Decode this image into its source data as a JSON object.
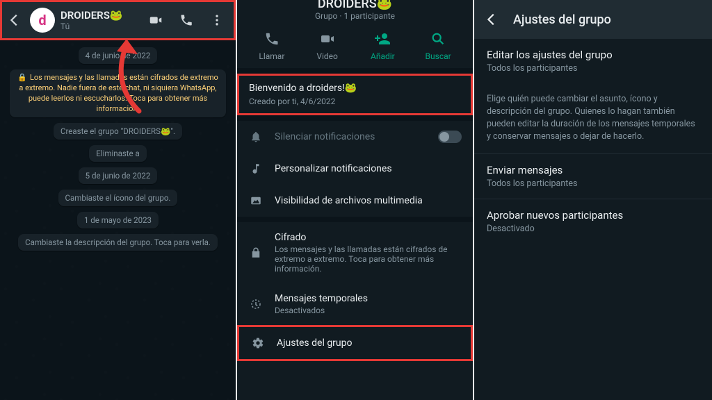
{
  "panel1": {
    "header": {
      "title": "DROIDERS🐸",
      "subtitle": "Tú"
    },
    "avatar_letter": "d",
    "messages": {
      "date1": "4 de junio de 2022",
      "encryption": "Los mensajes y las llamadas están cifrados de extremo a extremo. Nadie fuera de este chat, ni siquiera WhatsApp, puede leerlos ni escucharlos. Toca para obtener más información.",
      "created": "Creaste el grupo \"DROIDERS🐸\".",
      "eliminated": "Eliminaste a",
      "date2": "5 de junio de 2022",
      "icon_changed": "Cambiaste el ícono del grupo.",
      "date3": "1 de mayo de 2023",
      "desc_changed": "Cambiaste la descripción del grupo. Toca para verla."
    }
  },
  "panel2": {
    "group_title": "DROIDERS🐸",
    "group_sub": "Grupo · 1 participante",
    "actions": {
      "call": "Llamar",
      "video": "Video",
      "add": "Añadir",
      "search": "Buscar"
    },
    "welcome": {
      "title": "Bienvenido a droiders!🐸",
      "sub": "Creado por ti, 4/6/2022"
    },
    "menu": {
      "mute": "Silenciar notificaciones",
      "custom_notif": "Personalizar notificaciones",
      "media_vis": "Visibilidad de archivos multimedia",
      "encryption": "Cifrado",
      "encryption_sub": "Los mensajes y las llamadas están cifrados de extremo a extremo. Toca para obtener más información.",
      "temp": "Mensajes temporales",
      "temp_sub": "Desactivados",
      "settings": "Ajustes del grupo"
    }
  },
  "panel3": {
    "title": "Ajustes del grupo",
    "edit": {
      "title": "Editar los ajustes del grupo",
      "sub": "Todos los participantes"
    },
    "info": "Elige quién puede cambiar el asunto, ícono y descripción del grupo. Quienes lo hagan también pueden editar la duración de los mensajes temporales y conservar mensajes o dejar de hacerlo.",
    "send": {
      "title": "Enviar mensajes",
      "sub": "Todos los participantes"
    },
    "approve": {
      "title": "Aprobar nuevos participantes",
      "sub": "Desactivado"
    }
  }
}
